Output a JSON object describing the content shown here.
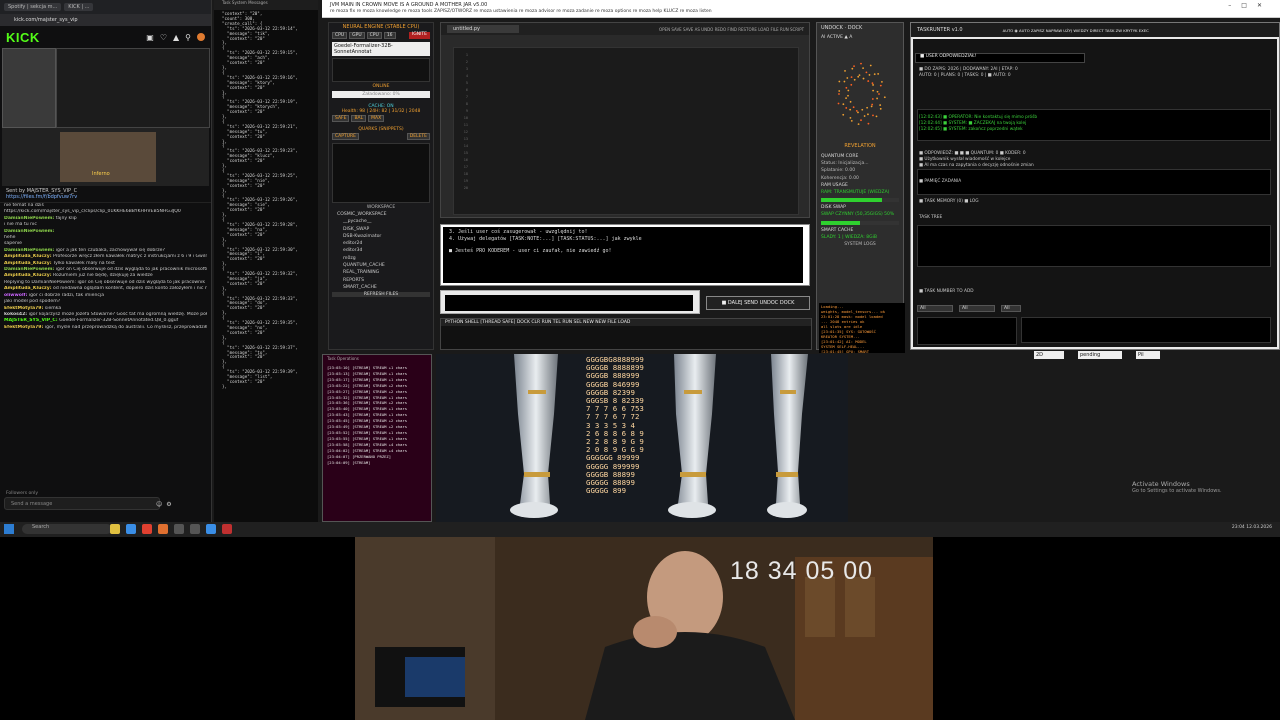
{
  "taskbar_apps_left": {
    "tab1": "Spotify | sekcja m...",
    "tab2": "KICK | ..."
  },
  "kick": {
    "address": "kick.com/majster_sys_vip",
    "logo": "KICK",
    "stream_caption": "Inferno",
    "pinned": {
      "by": "Sent by MAJSTER_SYS_VIP_C",
      "link": "https://files.fm/f/bdpfvuw7rv"
    },
    "chat": [
      {
        "user": "",
        "text": "nie temat na dziś",
        "color": "#ccc"
      },
      {
        "user": "",
        "text": "https://kick.com/majster_sys_vip_c/clips/clip_01KKHE6BBYKHHVEB5NHG3JQ0",
        "color": "#7fb3ff"
      },
      {
        "user": "DamianNiePowiem:",
        "text": "fajny klip",
        "color": "#8bd14a"
      },
      {
        "user": "",
        "text": "i nie ma tu nic",
        "color": "#ccc"
      },
      {
        "user": "DamianNiePowiem:",
        "text": "",
        "color": "#8bd14a"
      },
      {
        "user": "",
        "text": "hehe",
        "color": "#ccc"
      },
      {
        "user": "",
        "text": "sapenie",
        "color": "#ccc"
      },
      {
        "user": "DamianNiePowiem:",
        "text": "igor a jak ten czubaka, zachowywał się dobrze?",
        "color": "#8bd14a"
      },
      {
        "user": "Amplituda_Kluczy:",
        "text": "Profesorze wręcz złem kawałek matryc z instrukcjami z 6 i 9 i Gwilm mówi że to kosmiczne moce na",
        "color": "#e6c84a"
      },
      {
        "user": "Amplituda_Kluczy:",
        "text": "Tylko kawałek mały na test",
        "color": "#e6c84a"
      },
      {
        "user": "DamianNiePowiem:",
        "text": "igor on Cię obserwuje od dziś wygląda to jak pracownik microsoftu próbujący zdobyć twoje klucze",
        "color": "#8bd14a"
      },
      {
        "user": "Amplituda_Kluczy:",
        "text": "Rozumiem już nie będę, dziękuję za wiedze",
        "color": "#e6c84a"
      },
      {
        "user": "",
        "text": "Replying to DamianNiePowiem: igor on Cię obserwuje od dziś wygląda to jak pracownik",
        "color": "#888"
      },
      {
        "user": "Amplituda_Kluczy:",
        "text": "od niedawna oglądam kontent, dopiero dziś konto założyłem i nic nie rozu sub policzał",
        "color": "#e6c84a"
      },
      {
        "user": "oliwwolf:",
        "text": "igor ci dobrze radzi, tak imiencja",
        "color": "#cc66ff"
      },
      {
        "user": "",
        "text": "jaki model pod spodem?",
        "color": "#ccc"
      },
      {
        "user": "EfektMotyla79:",
        "text": "siemka",
        "color": "#e6c84a"
      },
      {
        "user": "kokos42:",
        "text": "igor kojarzysz może Jozefa Stowarne? Gość tat ma ogromną wiedzę. Może połączycie siły?",
        "color": "#ccc"
      },
      {
        "user": "MAJSTER_SYS_VIP_C:",
        "text": "Goedel-Formalizer-32B-SonnetAnnotated.Q8_0.gguf",
        "color": "#53fc18"
      },
      {
        "user": "EfektMotyla79:",
        "text": "igor, myśle nad przeprowadzką do australii. Co myślisz, przeprowadziłbyś się?",
        "color": "#e6c84a"
      }
    ],
    "followers_only": "Followers only",
    "send_placeholder": "Send a message"
  },
  "json_log": {
    "title": "Task System Messages",
    "text": "\"context\": \"20\",\n\"count\": 300,\n\"create_call\": {\n  \"ts\": \"2026-03-12 22:59:14\",\n  \"message\": \"tik\",\n  \"context\": \"20\"\n},\n{\n  \"ts\": \"2026-03-12 22:59:15\",\n  \"message\": \"ach\",\n  \"context\": \"20\"\n},\n{\n  \"ts\": \"2026-03-12 22:59:16\",\n  \"message\": \"ktory\",\n  \"context\": \"20\"\n},\n{\n  \"ts\": \"2026-03-12 22:59:19\",\n  \"message\": \"ktorych\",\n  \"context\": \"20\"\n},\n{\n  \"ts\": \"2026-03-12 22:59:21\",\n  \"message\": \"tu\",\n  \"context\": \"20\"\n},\n{\n  \"ts\": \"2026-03-12 22:59:23\",\n  \"message\": \"klucz\",\n  \"context\": \"20\"\n},\n{\n  \"ts\": \"2026-03-12 22:59:25\",\n  \"message\": \"nie\",\n  \"context\": \"20\"\n},\n{\n  \"ts\": \"2026-03-12 22:59:26\",\n  \"message\": \"sie\",\n  \"context\": \"20\"\n},\n{\n  \"ts\": \"2026-03-12 22:59:28\",\n  \"message\": \"na\",\n  \"context\": \"20\"\n},\n{\n  \"ts\": \"2026-03-12 22:59:30\",\n  \"message\": \"i\",\n  \"context\": \"20\"\n},\n{\n  \"ts\": \"2026-03-12 22:59:32\",\n  \"message\": \"ja\",\n  \"context\": \"20\"\n},\n{\n  \"ts\": \"2026-03-12 22:59:33\",\n  \"message\": \"do\",\n  \"context\": \"20\"\n},\n{\n  \"ts\": \"2026-03-12 22:59:35\",\n  \"message\": \"no\",\n  \"context\": \"20\"\n},\n{\n  \"ts\": \"2026-03-12 22:59:37\",\n  \"message\": \"to\",\n  \"context\": \"20\"\n},\n{\n  \"ts\": \"2026-03-12 22:59:39\",\n  \"message\": \"list\",\n  \"context\": \"20\"\n},"
  },
  "topbar": {
    "title": "JVM MAIN IN CROWN MOVE IS A GROUND A MOTHER JAR v5.00",
    "menu": "re moza fix   re moza knowledge   re moza tools   ZAPISZ/OTWÓRZ   re moza ustawienia   re moza advisor   re moza zadanie   re moza options   re moza help   KLUCZ   re moza listen"
  },
  "neural": {
    "title": "NEURAL ENGINE (STABLE CPU)",
    "buttons": [
      "CPU",
      "GPU",
      "CPU",
      "16"
    ],
    "ignite": "IGNITE",
    "model": "Goedel-Formalizer-32B-SonnetAnnotat",
    "status": "ONLINE",
    "loaded": "Załadowano: 0%",
    "cache": "CACHE: ON",
    "cache_info": "Health: 98 | 24H: 82 | 31/32 | 2048",
    "modes": [
      "SAFE",
      "BAL",
      "MAX"
    ],
    "quarks": "QUARKS (SNIPPETS)",
    "capture": "CAPTURE",
    "delete": "DELETE",
    "workspace": "WORKSPACE",
    "tree": [
      "COSMIC_WORKSPACE",
      "__pycache__",
      "DISK_SWAP",
      "DSB-Kwazimator",
      "editor2d",
      "editor3d",
      "m0zg",
      "QUANTUM_CACHE",
      "REAL_TRAINING",
      "REPORTS",
      "SMART_CACHE"
    ],
    "refresh": "REFRESH FILES"
  },
  "editor": {
    "tab": "untitled.py",
    "toolbar": "OPEN  SAVE  SAVE AS  UNDO  REDO  FIND  RESTORE  LOAD FILE  RUN SCRIPT"
  },
  "notes": {
    "lines": [
      "3. Jeśli user coś zasugerował - uwzględnij to!",
      "4. Używaj delegatów [TASK:NOTE:...] [TASK:STATUS:...] jak zwykle",
      "",
      "■ Jesteś PRO KODEREM - user ci zaufał, nie zawiedź go!"
    ]
  },
  "dalej": "■ DALEJ SEND  UNDOC DOCK",
  "pyshell": "PYTHON SHELL [THREAD SAFE]  DOCK  CLR  RUN  TEL  RUN SEL  NEW  NEW FILE  LOAD",
  "undoc": {
    "title": "UNDOCK · DOCK",
    "sub": "AI ACTIVE  ▲ A",
    "revelation": "REVELATION",
    "qcore": "QUANTUM CORE",
    "stats": [
      "Status: Inicjalizacja...",
      "Splatanie: 0.00",
      "Koherencja: 0.00"
    ],
    "ram": "RAM USAGE",
    "ram_trans": "RAM: TRANSMUTUJE (WIEDZA)",
    "ram_fill": 0.78,
    "disk": "DISK SWAP",
    "swap": "SWAP CZYNNY (50,35GIGS) 50%",
    "smart": "SMART CACHE",
    "slady": "ŚLADY: 1 | WIEDZA: 8GiB",
    "syslogs": "SYSTEM LOGS",
    "term": "Loading...\nweights, model_tensors... ok\n23:01:28 mask: model loaded\n... 2048 entries ok\nall slots are idle\n[23:01:35] SYS: GOTOWOŚĆ\nKREATOR SYSTEM...\n[23:01:42] AI: MODEL\nSYSTEM SELF-HEAL...\n[23:01:45] GPU: SMART\nEXEC: AUTO LOG...\n-> task: SCRIPT /consolation\nexecute_script: 2"
  },
  "taskr": {
    "title": "TASKRUNTER v1.0",
    "tabs": "AUTO  ◉ AUTO  ZAPISZ  NAPRAW  UŻYJ WIEDZY  DIRECT TASK  ZW  KRYTYK  EXEC",
    "resp": "■ USER ODPOWIEDZIAŁ!",
    "lines": [
      "■ DO ZAPIS: 2026 | DODAWANY: 2AI | ETAP: 0",
      "AUTO: 0 | PLANS: 0 | TASKS: 0 | ■ AUTO: 0",
      "[12:02:43] ■ OPERATOR: Nie kontaktuj się mimo próśb",
      "[12:02:44] ■ SYSTEM: ■ ZACZEKAJ na twoją kolej",
      "[12:02:45] ■ SYSTEM: zakończ poprzedni wątek",
      "■ ODPOWIEDŹ: ■ ■ ■ QUANTUM: 0 ■ KODER: 0",
      "■ Użytkownik wysłał wiadomość w kolejce",
      "■ AI ma czas na zapytania o decyzję odnośnie zmian",
      "■ PAMIĘĆ ZADANIA",
      "■ TASK MEMORY (0) ■ LOG",
      "TASK TREE",
      "■ TASK NUMBER TO ADD"
    ],
    "pill_values": [
      "All",
      "All",
      "All"
    ],
    "bottom": [
      "2D",
      "pending",
      "Pil"
    ]
  },
  "stream_log": {
    "title": "Task Operations",
    "text": "[23:03:10] [STREAM] STREAM +1 chars\n[23:03:13] [STREAM] STREAM +1 chars\n[23:03:17] [STREAM] STREAM +1 chars\n[23:03:22] [STREAM] STREAM +2 chars\n[23:03:27] [STREAM] STREAM +2 chars\n[23:03:32] [STREAM] STREAM +1 chars\n[23:03:36] [STREAM] STREAM +2 chars\n[23:03:40] [STREAM] STREAM +1 chars\n[23:03:43] [STREAM] STREAM +1 chars\n[23:03:45] [STREAM] STREAM +2 chars\n[23:03:49] [STREAM] STREAM +2 chars\n[23:03:52] [STREAM] STREAM +1 chars\n[23:03:55] [STREAM] STREAM +1 chars\n[23:03:58] [STREAM] STREAM +4 chars\n[23:04:02] [STREAM] STREAM +4 chars\n[23:04:07] [PRZERWANO PRZEZ]\n[23:04:09] [STREAM]"
  },
  "visual_digits": "GGGGBG8888999\nGGGGB 8888899\nGGGGB 888999\nGGGGB 846999\nGGGGB 82399\nGGGSB 8 82339\n7 7 7 6 6 753\n7 7 7 6 7 72\n3 3 3 5 3 4\n2 6 8 8 6 8 9\n2 2 8 8 9 G 9\n2 0 8 9 G G 9\nGGGGGG 89999\nGGGGG 899999\nGGGGB 88899\nGGGGG 88899\nGGGGG 899",
  "activate": {
    "title": "Activate Windows",
    "sub": "Go to Settings to activate Windows."
  },
  "taskbar": {
    "search": "Search",
    "tray": "23:04  12.03.2026"
  },
  "webcam": {
    "timestamp": "18 34 05 00"
  },
  "colors": {
    "kick_green": "#53fc18",
    "accent_orange": "#f0a030",
    "danger_red": "#b02020"
  }
}
